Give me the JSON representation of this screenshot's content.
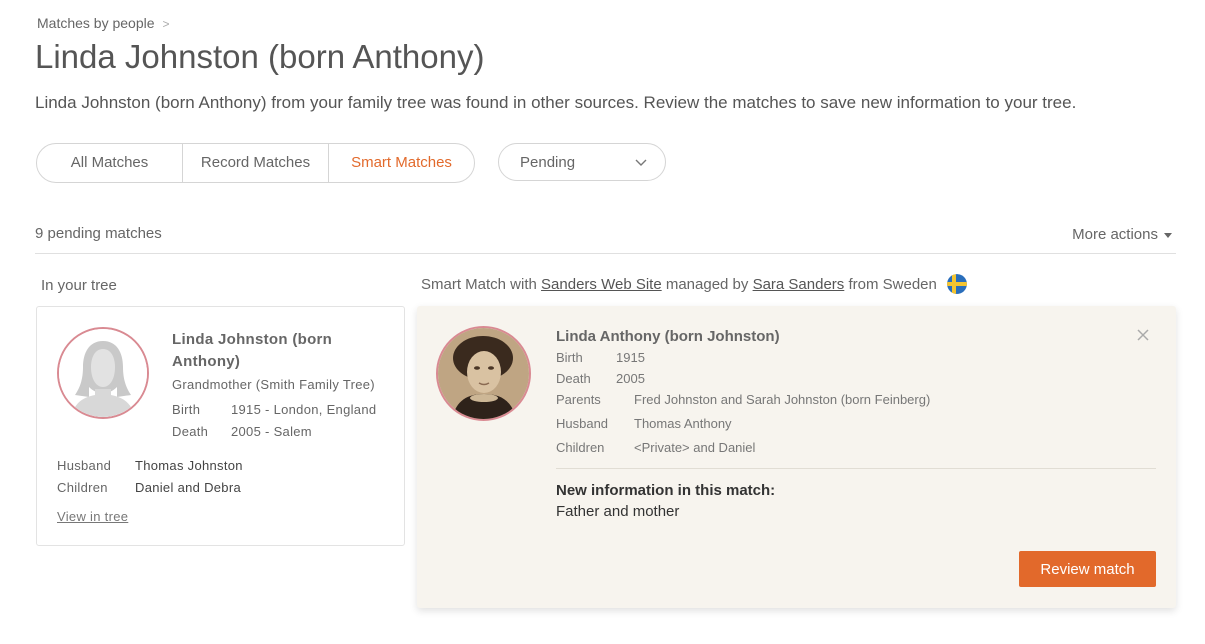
{
  "breadcrumb": {
    "label": "Matches by people",
    "separator": ">"
  },
  "page_title": "Linda Johnston (born Anthony)",
  "subtitle": "Linda Johnston (born Anthony) from your family tree was found in other sources. Review the matches to save new information to your tree.",
  "tabs": [
    {
      "label": "All Matches",
      "active": false
    },
    {
      "label": "Record Matches",
      "active": false
    },
    {
      "label": "Smart Matches",
      "active": true
    }
  ],
  "status_filter": {
    "selected": "Pending",
    "icon": "chevron-down-icon"
  },
  "pending_count": "9 pending matches",
  "more_actions": "More actions",
  "tree_section": {
    "heading": "In your tree",
    "name": "Linda Johnston (born Anthony)",
    "relation": "Grandmother (Smith Family Tree)",
    "birth_label": "Birth",
    "birth_value": "1915 - London, England",
    "death_label": "Death",
    "death_value": "2005 - Salem",
    "husband_label": "Husband",
    "husband_value": "Thomas Johnston",
    "children_label": "Children",
    "children_value": "Daniel and Debra",
    "view_link": "View in tree"
  },
  "match_section": {
    "heading_prefix": "Smart Match with",
    "site_link": "Sanders Web Site",
    "managed_by": "managed by",
    "manager_link": "Sara Sanders",
    "from_country": "from Sweden",
    "flag_icon": "sweden-flag-icon",
    "name": "Linda Anthony (born Johnston)",
    "birth_label": "Birth",
    "birth_value": "1915",
    "death_label": "Death",
    "death_value": "2005",
    "parents_label": "Parents",
    "parents_value": "Fred Johnston and Sarah Johnston (born Feinberg)",
    "husband_label": "Husband",
    "husband_value": "Thomas Anthony",
    "children_label": "Children",
    "children_value": "<Private> and Daniel",
    "new_info_title": "New information in this match:",
    "new_info_value": "Father and mother",
    "review_button": "Review match"
  },
  "colors": {
    "accent": "#e2692b",
    "avatar_border": "#d98a92",
    "match_card_bg": "#f7f4ee",
    "text": "#555555"
  }
}
